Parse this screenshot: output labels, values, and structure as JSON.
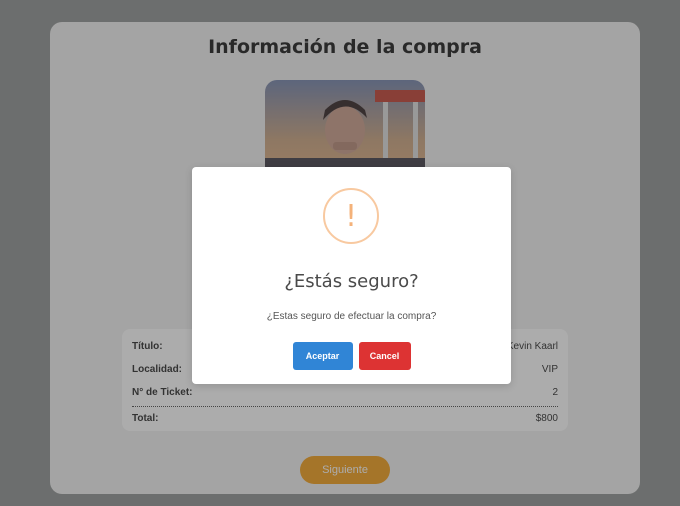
{
  "page": {
    "title": "Información de la compra",
    "next_label": "Siguiente"
  },
  "summary": {
    "rows": [
      {
        "label": "Título:",
        "value": "Kevin Kaarl"
      },
      {
        "label": "Localidad:",
        "value": "VIP"
      },
      {
        "label": "N° de Ticket:",
        "value": "2"
      }
    ],
    "total": {
      "label": "Total:",
      "value": "$800"
    }
  },
  "modal": {
    "icon": "!",
    "title": "¿Estás seguro?",
    "text": "¿Estas seguro de efectuar la compra?",
    "accept_label": "Aceptar",
    "cancel_label": "Cancel"
  },
  "colors": {
    "accept": "#3085d6",
    "cancel": "#dd3333",
    "next": "#f39c12",
    "warning": "#f8bb86"
  }
}
